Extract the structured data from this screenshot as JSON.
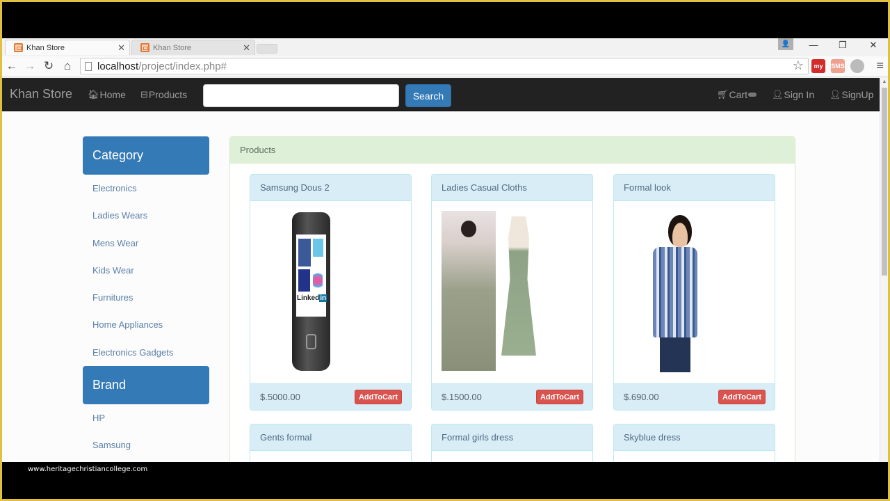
{
  "browser": {
    "tabs": [
      {
        "title": "Khan Store",
        "active": true
      },
      {
        "title": "Khan Store",
        "active": false
      }
    ],
    "url_host": "localhost",
    "url_path": "/project/index.php#",
    "window_controls": {
      "minimize": "—",
      "restore": "❐",
      "close": "✕"
    },
    "extensions": [
      {
        "name": "my-extension",
        "label": "my"
      },
      {
        "name": "extension-2",
        "label": "SMS"
      },
      {
        "name": "extension-3",
        "label": ""
      }
    ]
  },
  "navbar": {
    "brand": "Khan Store",
    "home": "Home",
    "products": "Products",
    "search_placeholder": "",
    "search_value": "",
    "search_button": "Search",
    "cart": "Cart",
    "sign_in": "Sign In",
    "sign_up": "SignUp"
  },
  "sidebar": {
    "category_title": "Category",
    "categories": [
      "Electronics",
      "Ladies Wears",
      "Mens Wear",
      "Kids Wear",
      "Furnitures",
      "Home Appliances",
      "Electronics Gadgets"
    ],
    "brand_title": "Brand",
    "brands": [
      "HP",
      "Samsung"
    ]
  },
  "products_panel": {
    "title": "Products",
    "add_label": "AddToCart",
    "items": [
      {
        "name": "Samsung Dous 2",
        "price": "$.5000.00",
        "image": "phone"
      },
      {
        "name": "Ladies Casual Cloths",
        "price": "$.1500.00",
        "image": "dress"
      },
      {
        "name": "Formal look",
        "price": "$.690.00",
        "image": "boy"
      },
      {
        "name": "Gents formal"
      },
      {
        "name": "Formal girls dress"
      },
      {
        "name": "Skyblue dress"
      }
    ]
  },
  "watermark": "www.heritagechristiancollege.com",
  "colors": {
    "primary": "#337ab7",
    "danger": "#d9534f",
    "navbar": "#222222",
    "panel_success": "#dff0d8",
    "card_info": "#d9edf7"
  }
}
